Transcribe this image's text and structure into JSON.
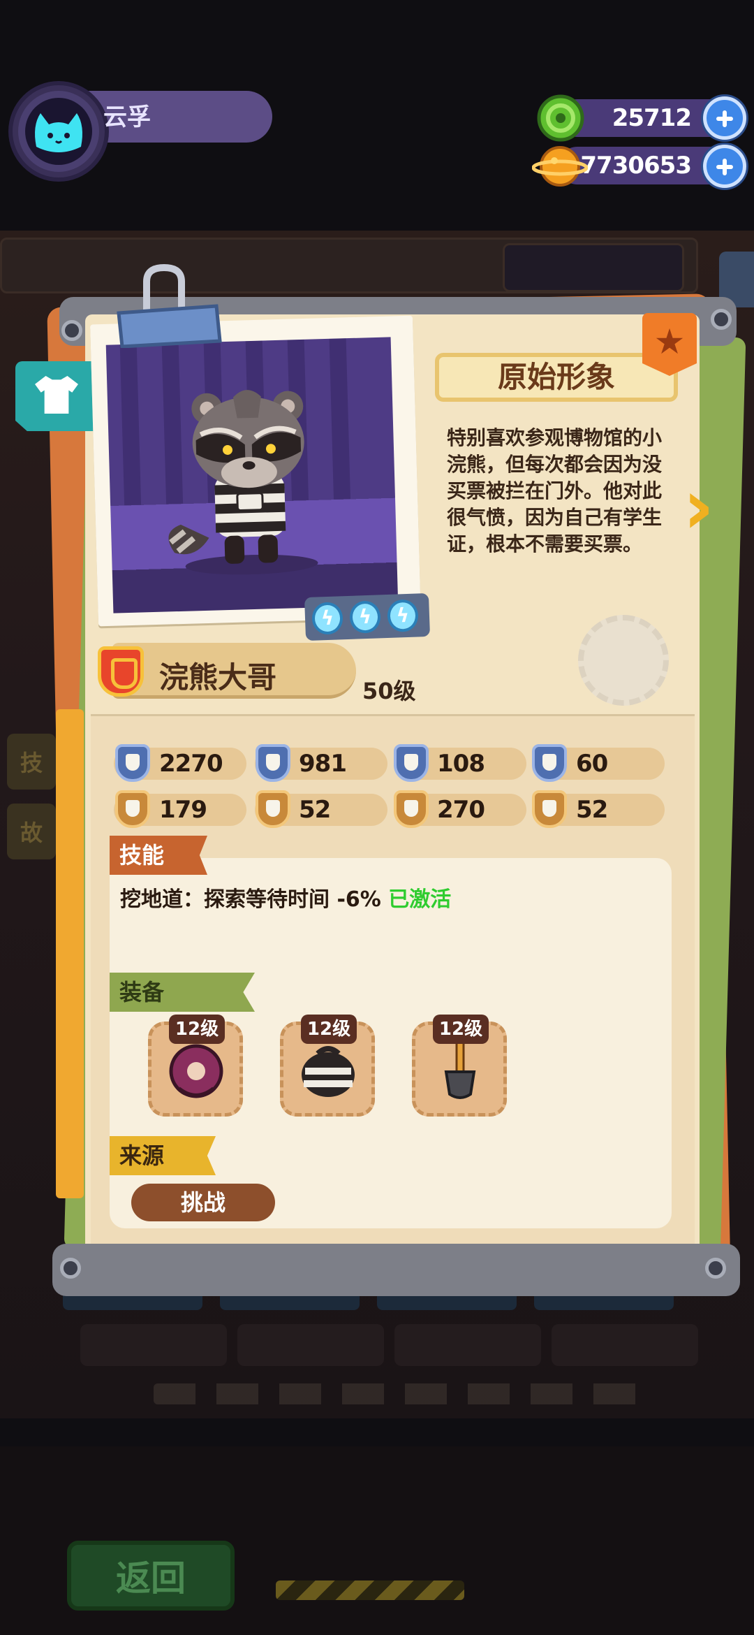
{
  "player": {
    "name": "云孚"
  },
  "currencies": [
    {
      "icon": "green-coin-icon",
      "value": "25712"
    },
    {
      "icon": "orange-planet-coin-icon",
      "value": "7730653"
    }
  ],
  "card": {
    "skin_title": "原始形象",
    "description": "特别喜欢参观博物馆的小浣熊，但每次都会因为没买票被拦在门外。他对此很气愤，因为自己有学生证，根本不需要买票。",
    "character_name": "浣熊大哥",
    "level": "50级",
    "stats": [
      {
        "icon": "heart-shield-icon",
        "value": "2270",
        "color": "blue"
      },
      {
        "icon": "sword-shield-icon",
        "value": "981",
        "color": "blue"
      },
      {
        "icon": "defense-shield-icon",
        "value": "108",
        "color": "blue"
      },
      {
        "icon": "speed-shield-icon",
        "value": "60",
        "color": "blue"
      },
      {
        "icon": "leg-icon",
        "value": "179",
        "color": "gold"
      },
      {
        "icon": "smile-icon",
        "value": "52",
        "color": "gold"
      },
      {
        "icon": "strength-arm-icon",
        "value": "270",
        "color": "gold"
      },
      {
        "icon": "brain-icon",
        "value": "52",
        "color": "gold"
      }
    ],
    "skill_tag": "技能",
    "skill_text": "挖地道：探索等待时间 -6%",
    "skill_status": "已激活",
    "equip_tag": "装备",
    "equipment": [
      {
        "icon": "ring-donut-icon",
        "level": "12级"
      },
      {
        "icon": "striped-bag-icon",
        "level": "12级"
      },
      {
        "icon": "shovel-icon",
        "level": "12级"
      }
    ],
    "source_tag": "来源",
    "source_button": "挑战"
  },
  "background": {
    "back_button": "返回"
  },
  "colors": {
    "accent_green": "#2fcc2f",
    "panel": "#f3e4c3",
    "skill_tag": "#c7642f",
    "equip_tag": "#8fa74f",
    "source_tag": "#e8b42c"
  }
}
